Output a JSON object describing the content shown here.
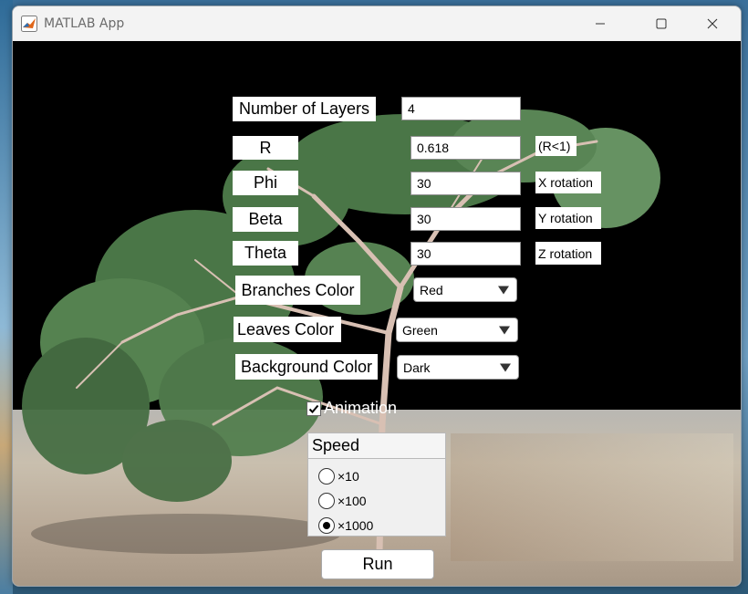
{
  "window": {
    "title": "MATLAB App",
    "icon": "matlab-icon"
  },
  "controls": {
    "layers": {
      "label": "Number of Layers",
      "value": "4"
    },
    "r": {
      "label": "R",
      "value": "0.618",
      "hint": "(R<1)"
    },
    "phi": {
      "label": "Phi",
      "value": "30",
      "hint": "X rotation"
    },
    "beta": {
      "label": "Beta",
      "value": "30",
      "hint": "Y rotation"
    },
    "theta": {
      "label": "Theta",
      "value": "30",
      "hint": "Z rotation"
    },
    "branches_color": {
      "label": "Branches Color",
      "selected": "Red"
    },
    "leaves_color": {
      "label": "Leaves Color",
      "selected": "Green"
    },
    "background_color": {
      "label": "Background Color",
      "selected": "Dark"
    }
  },
  "animation": {
    "label": "Animation",
    "checked": true
  },
  "speed": {
    "title": "Speed",
    "options": [
      "×10",
      "×100",
      "×1000"
    ],
    "selected": "×1000"
  },
  "run": {
    "label": "Run"
  },
  "colors": {
    "sky": "#000000",
    "leaves": "#5f8f5a",
    "branches": "#d9c2b5"
  }
}
